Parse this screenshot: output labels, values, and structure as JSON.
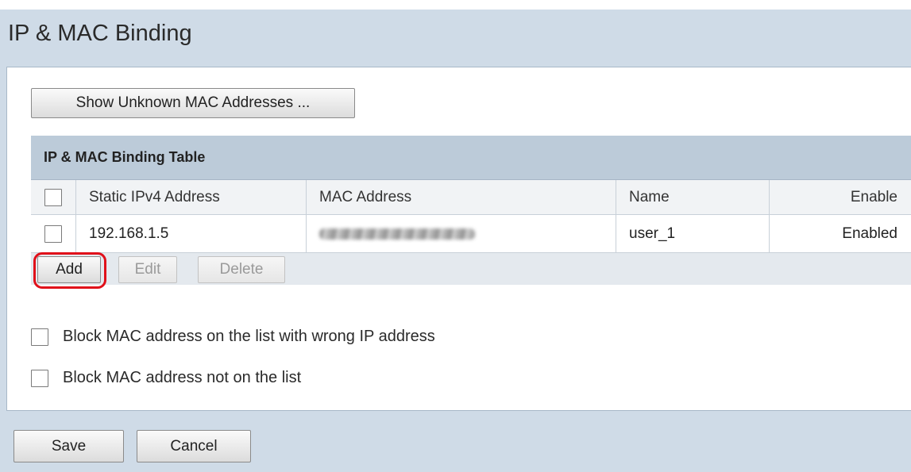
{
  "page": {
    "title": "IP & MAC Binding"
  },
  "toolbar": {
    "show_unknown_label": "Show Unknown MAC Addresses ..."
  },
  "table": {
    "title": "IP & MAC Binding Table",
    "columns": [
      "Static IPv4 Address",
      "MAC Address",
      "Name",
      "Enable"
    ],
    "rows": [
      {
        "ip": "192.168.1.5",
        "mac": "",
        "name": "user_1",
        "enable": "Enabled"
      }
    ],
    "actions": {
      "add": "Add",
      "edit": "Edit",
      "delete": "Delete"
    }
  },
  "options": {
    "block_wrong_ip": "Block MAC address on the list with wrong IP address",
    "block_not_listed": "Block MAC address not on the list"
  },
  "footer": {
    "save": "Save",
    "cancel": "Cancel"
  },
  "colors": {
    "highlight": "#e0101a",
    "background": "#cfdbe7",
    "table_header": "#bccbd9"
  }
}
